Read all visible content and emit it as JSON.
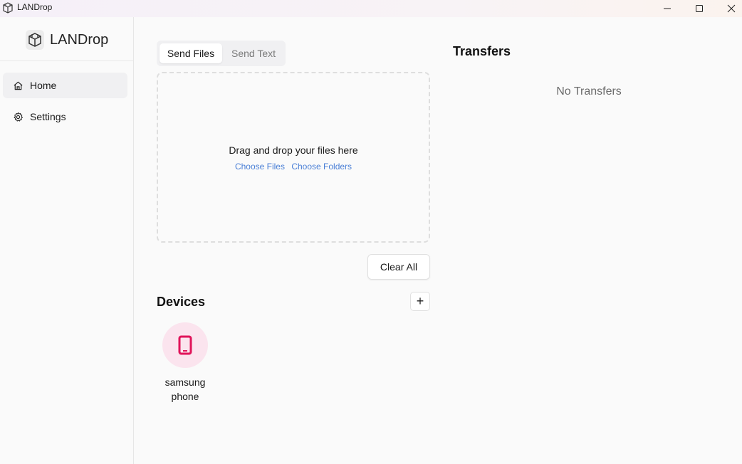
{
  "window": {
    "title": "LANDrop"
  },
  "sidebar": {
    "brand": "LANDrop",
    "items": [
      {
        "label": "Home",
        "icon": "home-icon"
      },
      {
        "label": "Settings",
        "icon": "gear-icon"
      }
    ]
  },
  "send": {
    "tabs": [
      "Send Files",
      "Send Text"
    ],
    "selected_tab": "Send Files",
    "drop_message": "Drag and drop your files here",
    "choose_files": "Choose Files",
    "choose_folders": "Choose Folders",
    "clear_all": "Clear All"
  },
  "devices": {
    "title": "Devices",
    "add_label": "+",
    "items": [
      {
        "name": "samsung phone",
        "icon": "smartphone-icon"
      }
    ]
  },
  "transfers": {
    "title": "Transfers",
    "empty_message": "No Transfers"
  },
  "colors": {
    "accent_link": "#4a7fd6",
    "device_icon": "#e0145a",
    "device_bg": "#fbe4ee"
  }
}
